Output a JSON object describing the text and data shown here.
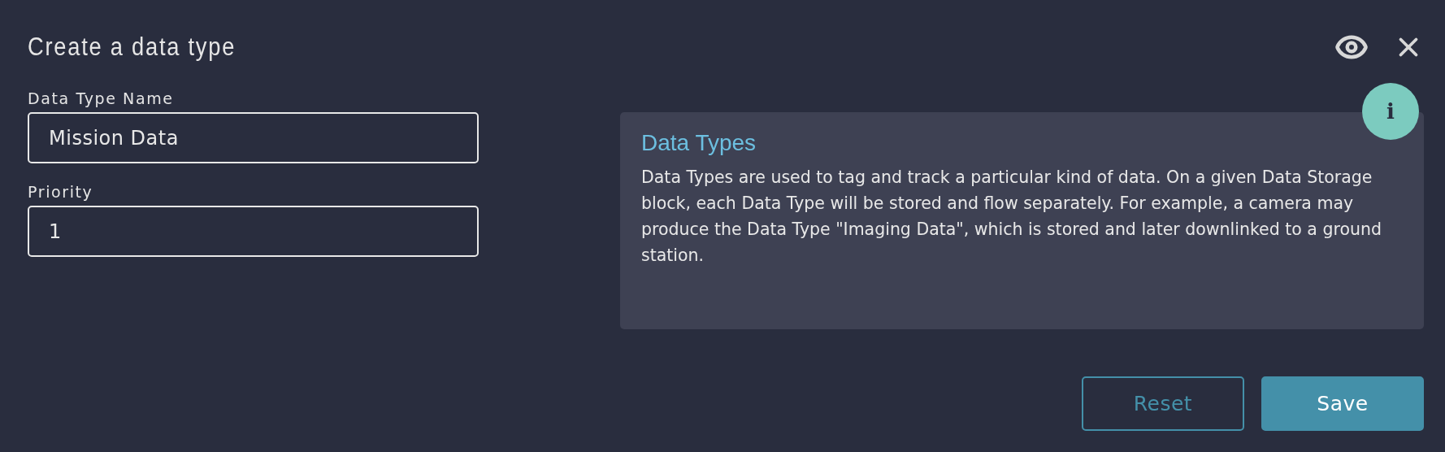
{
  "dialog": {
    "title": "Create a data type"
  },
  "fields": [
    {
      "label": "Data Type Name",
      "value": "Mission Data"
    },
    {
      "label": "Priority",
      "value": "1"
    }
  ],
  "info": {
    "badge": "i",
    "title": "Data Types",
    "text": "Data Types are used to tag and track a particular kind of data. On a given Data Storage block, each Data Type will be stored and flow separately. For example, a camera may produce the Data Type \"Imaging Data\", which is stored and later downlinked to a ground station."
  },
  "buttons": [
    {
      "label": "Reset",
      "kind": "outline"
    },
    {
      "label": "Save",
      "kind": "primary"
    }
  ]
}
